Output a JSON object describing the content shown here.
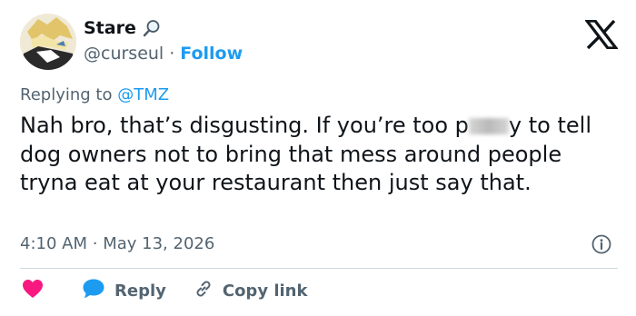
{
  "user": {
    "display_name": "Stare",
    "handle": "@curseul",
    "separator": "·",
    "follow_label": "Follow"
  },
  "reply_context": {
    "prefix": "Replying to ",
    "mention": "@TMZ"
  },
  "tweet": {
    "text_before": "Nah bro, that’s disgusting. If you’re too p",
    "text_after": "y to tell dog owners not to bring that mess around people tryna eat at your restaurant then just say that.",
    "time": "4:10 AM",
    "separator": "·",
    "date": "May 13, 2026"
  },
  "actions": {
    "reply_label": "Reply",
    "copy_link_label": "Copy link"
  },
  "colors": {
    "accent": "#1d9bf0",
    "like": "#f91880",
    "muted": "#536471",
    "text": "#0f1419",
    "divider": "#cfd9de"
  },
  "icons": [
    "magnifying-glass-icon",
    "x-logo-icon",
    "info-icon",
    "heart-icon",
    "speech-bubble-icon",
    "link-icon"
  ]
}
